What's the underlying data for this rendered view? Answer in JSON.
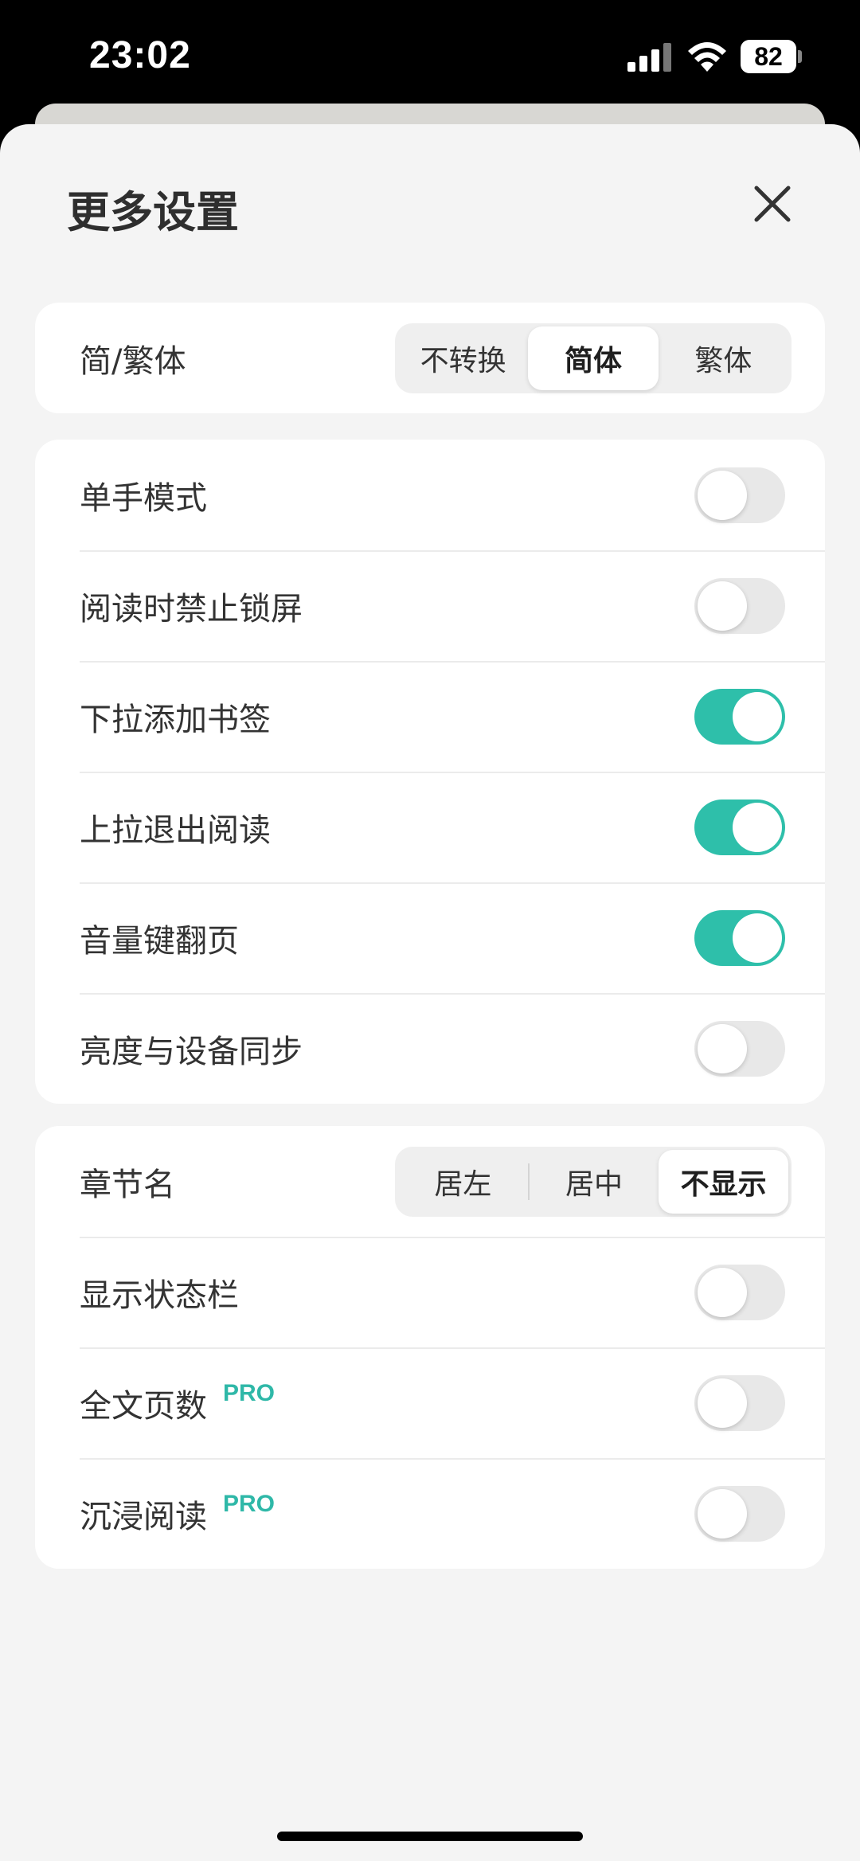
{
  "status_bar": {
    "time": "23:02",
    "battery": "82"
  },
  "sheet": {
    "title": "更多设置"
  },
  "script_setting": {
    "label": "简/繁体",
    "options": [
      "不转换",
      "简体",
      "繁体"
    ],
    "selected": "简体"
  },
  "toggles": [
    {
      "label": "单手模式",
      "on": false
    },
    {
      "label": "阅读时禁止锁屏",
      "on": false
    },
    {
      "label": "下拉添加书签",
      "on": true
    },
    {
      "label": "上拉退出阅读",
      "on": true
    },
    {
      "label": "音量键翻页",
      "on": true
    },
    {
      "label": "亮度与设备同步",
      "on": false
    }
  ],
  "chapter_name": {
    "label": "章节名",
    "options": [
      "居左",
      "居中",
      "不显示"
    ],
    "selected": "不显示"
  },
  "display_toggles": [
    {
      "label": "显示状态栏",
      "on": false,
      "badge": ""
    },
    {
      "label": "全文页数",
      "on": false,
      "badge": "PRO"
    },
    {
      "label": "沉浸阅读",
      "on": false,
      "badge": "PRO"
    }
  ],
  "colors": {
    "accent": "#2ebfaa",
    "pro": "#2fb8a8"
  }
}
